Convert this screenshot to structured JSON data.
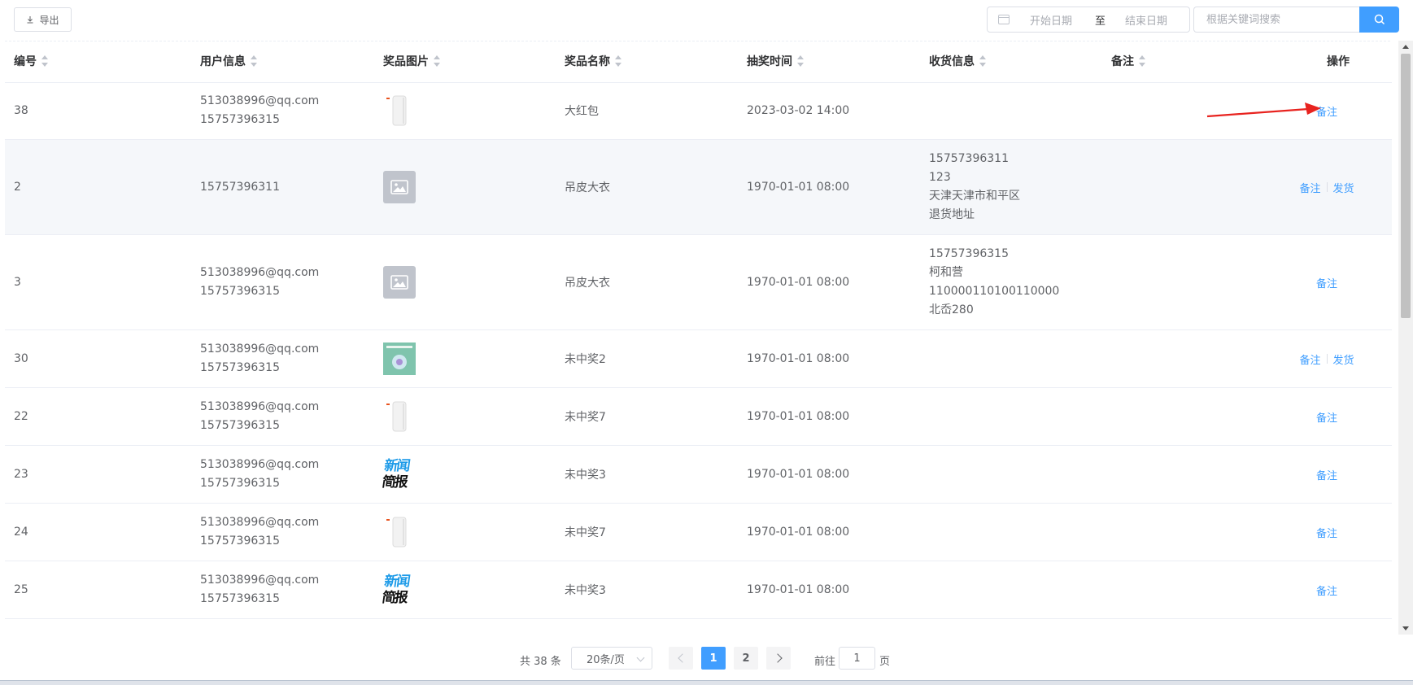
{
  "toolbar": {
    "export_label": "导出",
    "date_start_placeholder": "开始日期",
    "date_separator": "至",
    "date_end_placeholder": "结束日期",
    "search_placeholder": "根据关键词搜索"
  },
  "table": {
    "headers": [
      "编号",
      "用户信息",
      "奖品图片",
      "奖品名称",
      "抽奖时间",
      "收货信息",
      "备注",
      "操作"
    ],
    "rows": [
      {
        "id": "38",
        "user": [
          "513038996@qq.com",
          "15757396315"
        ],
        "image": "product-thumbnail",
        "prize": "大红包",
        "time": "2023-03-02 14:00",
        "address": [],
        "actions": [
          "备注"
        ]
      },
      {
        "id": "2",
        "user": [
          "15757396311"
        ],
        "image": "image-placeholder",
        "prize": "吊皮大衣",
        "time": "1970-01-01 08:00",
        "address": [
          "15757396311",
          "123",
          "天津天津市和平区",
          "退货地址"
        ],
        "actions": [
          "备注",
          "发货"
        ]
      },
      {
        "id": "3",
        "user": [
          "513038996@qq.com",
          "15757396315"
        ],
        "image": "image-placeholder",
        "prize": "吊皮大衣",
        "time": "1970-01-01 08:00",
        "address": [
          "15757396315",
          "柯和营",
          "110000110100110000",
          "北岙280"
        ],
        "actions": [
          "备注"
        ]
      },
      {
        "id": "30",
        "user": [
          "513038996@qq.com",
          "15757396315"
        ],
        "image": "cover-thumbnail",
        "prize": "未中奖2",
        "time": "1970-01-01 08:00",
        "address": [],
        "actions": [
          "备注",
          "发货"
        ]
      },
      {
        "id": "22",
        "user": [
          "513038996@qq.com",
          "15757396315"
        ],
        "image": "product-thumbnail",
        "prize": "未中奖7",
        "time": "1970-01-01 08:00",
        "address": [],
        "actions": [
          "备注"
        ]
      },
      {
        "id": "23",
        "user": [
          "513038996@qq.com",
          "15757396315"
        ],
        "image": "news-thumbnail",
        "prize": "未中奖3",
        "time": "1970-01-01 08:00",
        "address": [],
        "actions": [
          "备注"
        ]
      },
      {
        "id": "24",
        "user": [
          "513038996@qq.com",
          "15757396315"
        ],
        "image": "product-thumbnail",
        "prize": "未中奖7",
        "time": "1970-01-01 08:00",
        "address": [],
        "actions": [
          "备注"
        ]
      },
      {
        "id": "25",
        "user": [
          "513038996@qq.com",
          "15757396315"
        ],
        "image": "news-thumbnail",
        "prize": "未中奖3",
        "time": "1970-01-01 08:00",
        "address": [],
        "actions": [
          "备注"
        ]
      }
    ]
  },
  "news_thumb_text": [
    "新闻",
    "简报"
  ],
  "pagination": {
    "total": "共 38 条",
    "page_size": "20条/页",
    "pages": [
      "1",
      "2"
    ],
    "current_page": "1",
    "goto_label": "前往",
    "goto_value": "1",
    "goto_suffix": "页"
  },
  "colors": {
    "primary": "#409eff",
    "header_text": "#303133",
    "text": "#606266",
    "annotation_arrow": "#e8231f"
  }
}
